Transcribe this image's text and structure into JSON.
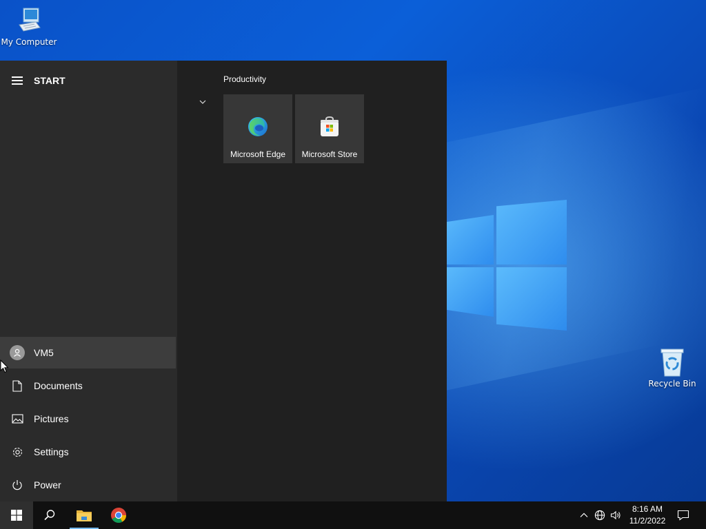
{
  "desktop": {
    "icons": [
      {
        "label": "My Computer",
        "icon": "computer-icon"
      },
      {
        "label": "Recycle Bin",
        "icon": "recycle-bin-icon"
      }
    ]
  },
  "start_menu": {
    "title": "START",
    "nav": [
      {
        "label": "VM5",
        "icon": "user-icon"
      },
      {
        "label": "Documents",
        "icon": "document-icon"
      },
      {
        "label": "Pictures",
        "icon": "pictures-icon"
      },
      {
        "label": "Settings",
        "icon": "gear-icon"
      },
      {
        "label": "Power",
        "icon": "power-icon"
      }
    ],
    "group": {
      "label": "Productivity",
      "tiles": [
        {
          "label": "Microsoft Edge",
          "icon": "edge-icon"
        },
        {
          "label": "Microsoft Store",
          "icon": "store-icon"
        }
      ]
    }
  },
  "taskbar": {
    "apps": [
      {
        "icon": "windows-logo-icon"
      },
      {
        "icon": "search-icon"
      },
      {
        "icon": "file-explorer-icon"
      },
      {
        "icon": "chrome-icon"
      }
    ],
    "tray": {
      "time": "8:16 AM",
      "date": "11/2/2022"
    }
  },
  "colors": {
    "menu_bg": "#202020",
    "menu_left_bg": "#2b2b2b",
    "tile_bg": "#373737",
    "taskbar_bg": "#101010",
    "accent": "#76b9ed"
  }
}
